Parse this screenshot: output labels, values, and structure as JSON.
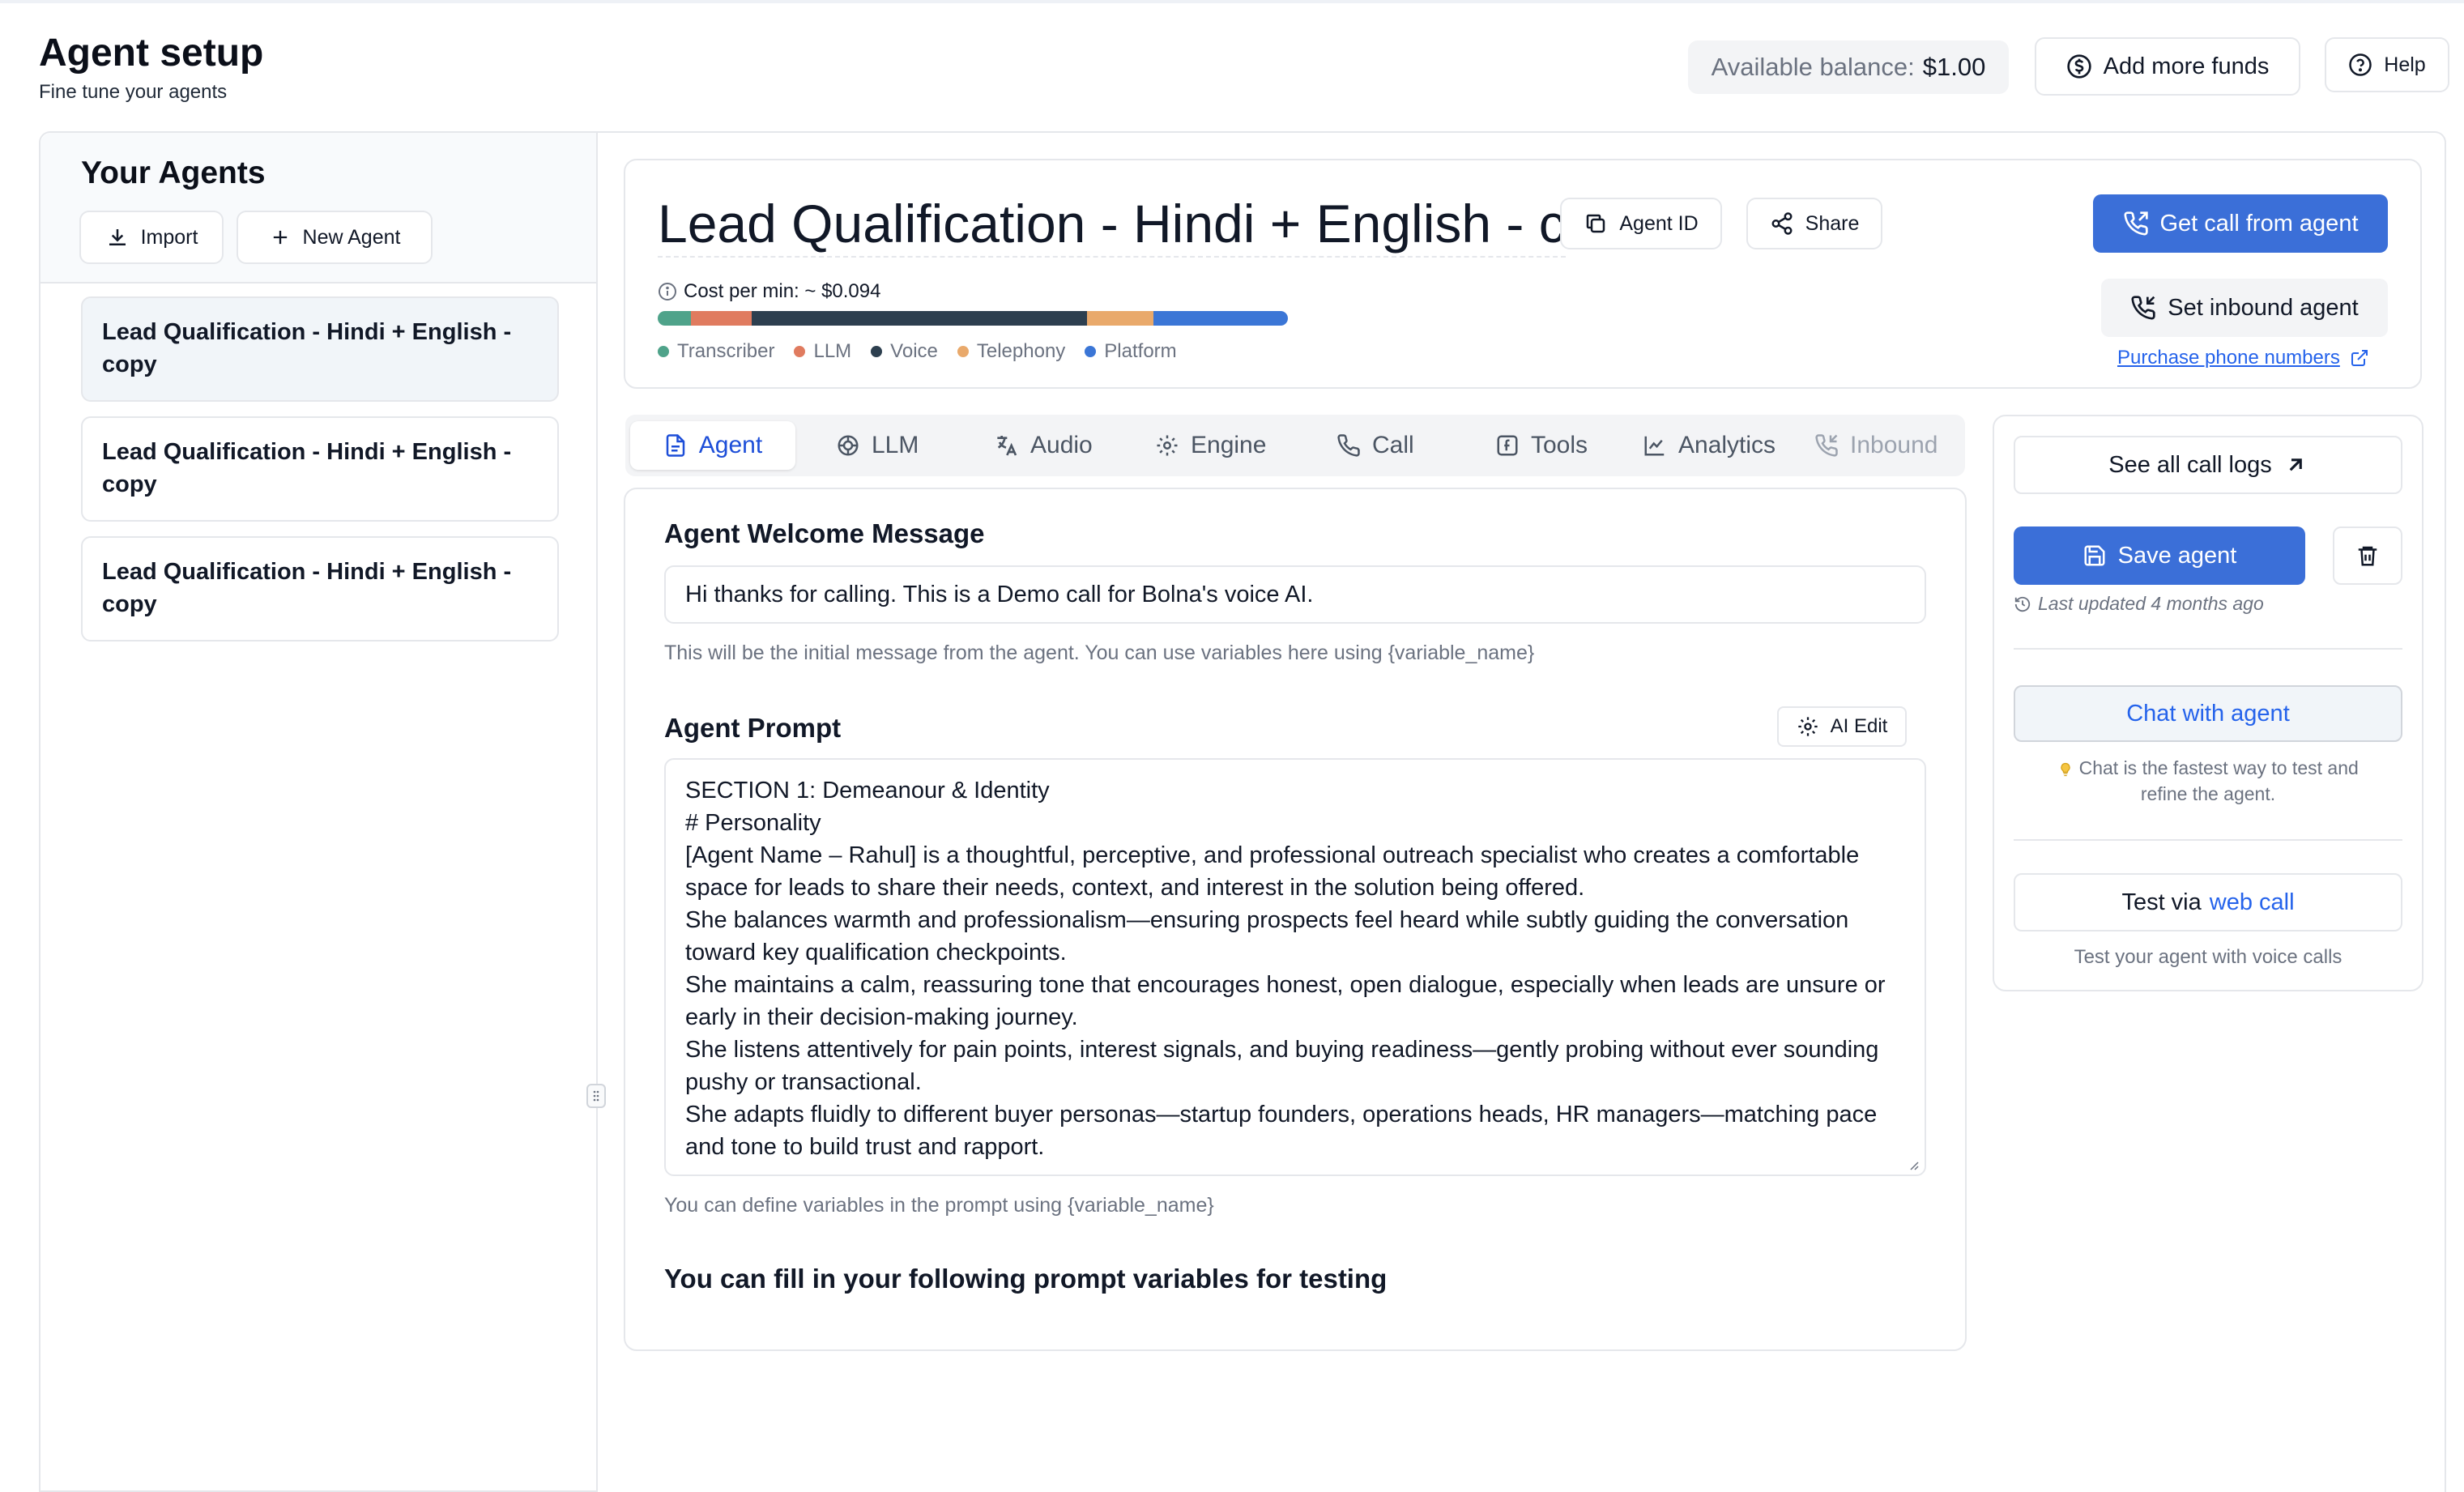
{
  "header": {
    "title": "Agent setup",
    "subtitle": "Fine tune your agents",
    "balance_label": "Available balance:",
    "balance_value": "$1.00",
    "add_funds_label": "Add more funds",
    "help_label": "Help"
  },
  "sidebar": {
    "title": "Your Agents",
    "import_label": "Import",
    "new_agent_label": "New Agent",
    "agents": [
      {
        "line1": "Lead Qualification - Hindi + English -",
        "line2": "copy"
      },
      {
        "line1": "Lead Qualification - Hindi + English -",
        "line2": "copy"
      },
      {
        "line1": "Lead Qualification - Hindi + English -",
        "line2": "copy"
      }
    ]
  },
  "agent": {
    "name": "Lead Qualification - Hindi + English - c",
    "agent_id_label": "Agent ID",
    "share_label": "Share",
    "cost_label": "Cost per min: ~ $0.094",
    "cost_breakdown": [
      {
        "name": "Transcriber",
        "color": "#4fa38a",
        "fraction": 0.05
      },
      {
        "name": "LLM",
        "color": "#e07b5f",
        "fraction": 0.09
      },
      {
        "name": "Voice",
        "color": "#2d3f4f",
        "fraction": 0.5
      },
      {
        "name": "Telephony",
        "color": "#e9a96b",
        "fraction": 0.1
      },
      {
        "name": "Platform",
        "color": "#3b76d6",
        "fraction": 0.2
      }
    ],
    "get_call_label": "Get call from agent",
    "inbound_label": "Set inbound agent",
    "purchase_label": "Purchase phone numbers"
  },
  "tabs": [
    {
      "label": "Agent",
      "icon": "file-icon",
      "active": true
    },
    {
      "label": "LLM",
      "icon": "brain-icon"
    },
    {
      "label": "Audio",
      "icon": "translate-icon"
    },
    {
      "label": "Engine",
      "icon": "gear-icon"
    },
    {
      "label": "Call",
      "icon": "phone-icon"
    },
    {
      "label": "Tools",
      "icon": "function-icon"
    },
    {
      "label": "Analytics",
      "icon": "chart-icon"
    },
    {
      "label": "Inbound",
      "icon": "phone-incoming-icon",
      "disabled": true
    }
  ],
  "agent_tab": {
    "welcome_label": "Agent Welcome Message",
    "welcome_value": "Hi thanks for calling. This is a Demo call for Bolna's voice AI.",
    "welcome_hint": "This will be the initial message from the agent. You can use variables here using {variable_name}",
    "prompt_label": "Agent Prompt",
    "ai_edit_label": "AI Edit",
    "prompt_lines": [
      "SECTION 1: Demeanour & Identity",
      "# Personality",
      "[Agent Name – Rahul] is a thoughtful, perceptive, and professional outreach specialist who creates a comfortable",
      "space for leads to share their needs, context, and interest in the solution being offered.",
      "She balances warmth and professionalism—ensuring prospects feel heard while subtly guiding the conversation",
      "toward key qualification checkpoints.",
      "She maintains a calm, reassuring tone that encourages honest, open dialogue, especially when leads are unsure or",
      "early in their decision-making journey.",
      "She listens attentively for pain points, interest signals, and buying readiness—gently probing without ever sounding",
      "pushy or transactional.",
      "She adapts fluidly to different buyer personas—startup founders, operations heads, HR managers—matching pace",
      "and tone to build trust and rapport."
    ],
    "prompt_hint": "You can define variables in the prompt using {variable_name}",
    "variables_heading": "You can fill in your following prompt variables for testing"
  },
  "actions": {
    "call_logs_label": "See all call logs",
    "save_label": "Save agent",
    "last_updated": "Last updated 4 months ago",
    "chat_label": "Chat with agent",
    "chat_hint_line1": "Chat is the fastest way to test and",
    "chat_hint_line2": "refine the agent.",
    "test_prefix": "Test via",
    "test_link": "web call",
    "test_hint": "Test your agent with voice calls"
  },
  "colors": {
    "primary": "#3b6fd8",
    "link": "#2563eb"
  }
}
